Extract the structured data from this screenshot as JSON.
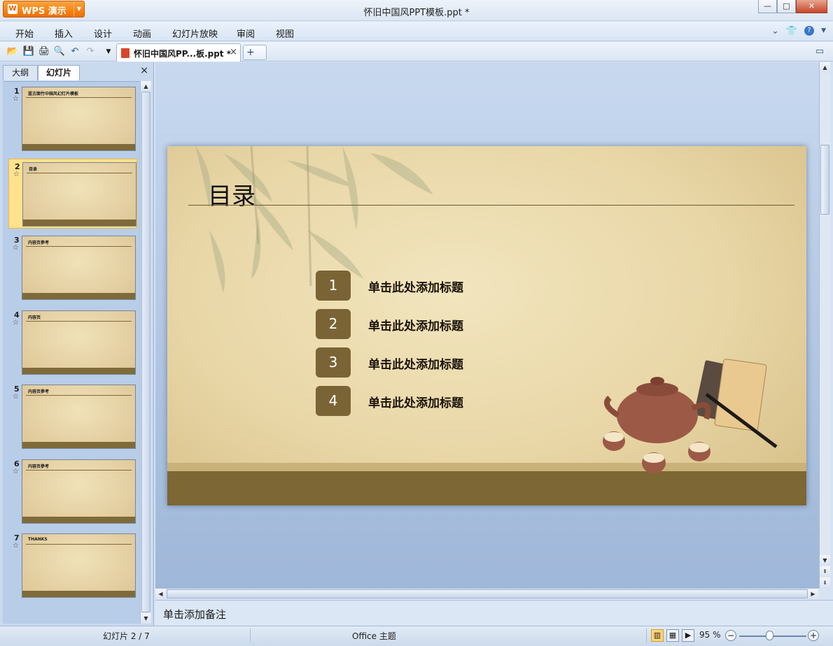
{
  "app": {
    "button_label": "WPS 演示",
    "logo_letter": "W",
    "title": "怀旧中国风PPT模板.ppt *"
  },
  "window_controls": {
    "minimize": "—",
    "maximize": "□",
    "close": "✕"
  },
  "menu": [
    "开始",
    "插入",
    "设计",
    "动画",
    "幻灯片放映",
    "审阅",
    "视图"
  ],
  "toolbar": {
    "doc_tab_label": "怀旧中国风PP...板.ppt *",
    "doc_tab_close": "×",
    "new_tab": "+"
  },
  "panel": {
    "tabs": [
      "大纲",
      "幻灯片"
    ],
    "active_tab": "幻灯片",
    "close": "×"
  },
  "thumbnails": [
    {
      "num": "1",
      "star": "☆",
      "text": "蓝古面竹中国风幻灯片模板"
    },
    {
      "num": "2",
      "star": "☆",
      "text": "目录"
    },
    {
      "num": "3",
      "star": "☆",
      "text": "内容页參考"
    },
    {
      "num": "4",
      "star": "☆",
      "text": "内容页"
    },
    {
      "num": "5",
      "star": "☆",
      "text": "内容页參考"
    },
    {
      "num": "6",
      "star": "☆",
      "text": "内容页參考"
    },
    {
      "num": "7",
      "star": "☆",
      "text": "THANKS"
    }
  ],
  "selected_slide": 2,
  "slide": {
    "title": "目录",
    "items": [
      {
        "num": "1",
        "text": "单击此处添加标题"
      },
      {
        "num": "2",
        "text": "单击此处添加标题"
      },
      {
        "num": "3",
        "text": "单击此处添加标题"
      },
      {
        "num": "4",
        "text": "单击此处添加标题"
      }
    ]
  },
  "notes": {
    "placeholder": "单击添加备注"
  },
  "status": {
    "slide_counter": "幻灯片 2 / 7",
    "theme": "Office 主题",
    "zoom": "95 %"
  },
  "colors": {
    "accent": "#7a6436",
    "wps_orange": "#ef6d00",
    "selection": "#ffe28c"
  }
}
